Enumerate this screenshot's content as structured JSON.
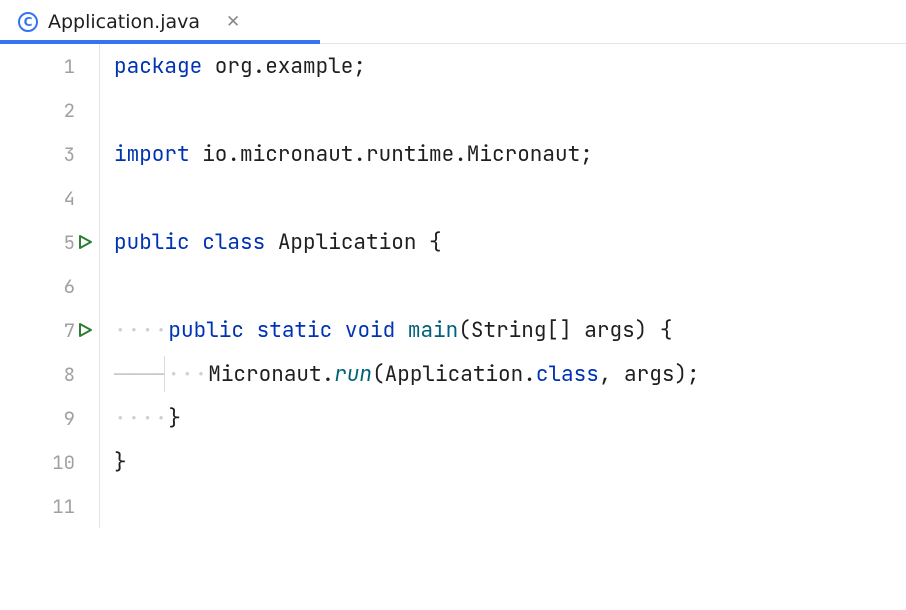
{
  "tab": {
    "filename": "Application.java",
    "icon_letter": "C"
  },
  "code": {
    "lines": [
      {
        "n": "1"
      },
      {
        "n": "2"
      },
      {
        "n": "3"
      },
      {
        "n": "4"
      },
      {
        "n": "5"
      },
      {
        "n": "6"
      },
      {
        "n": "7"
      },
      {
        "n": "8"
      },
      {
        "n": "9"
      },
      {
        "n": "10"
      },
      {
        "n": "11"
      }
    ],
    "kw_package": "package",
    "pkg_name": " org.example;",
    "kw_import": "import",
    "import_name": " io.micronaut.runtime.Micronaut;",
    "kw_public": "public",
    "kw_class": "class",
    "class_name": " Application ",
    "brace_open": "{",
    "kw_static": "static",
    "kw_void": "void",
    "main_name": "main",
    "main_params": "(String[] args) ",
    "l8_prefix": "Micronaut.",
    "l8_run": "run",
    "l8_mid": "(Application.",
    "kw_classref": "class",
    "l8_suffix": ", args);",
    "brace_close_inner": "}",
    "brace_close_outer": "}",
    "sp": " "
  }
}
